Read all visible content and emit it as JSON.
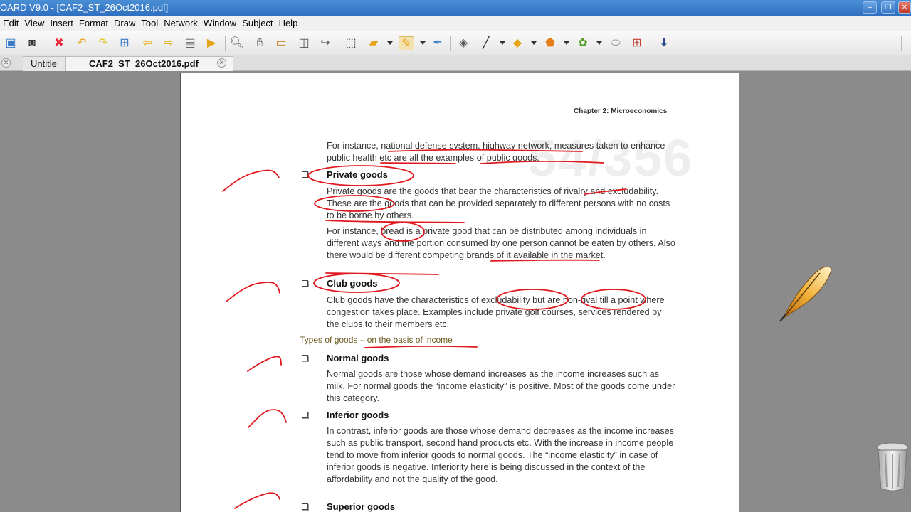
{
  "window": {
    "title": "OARD V9.0 - [CAF2_ST_26Oct2016.pdf]"
  },
  "menu": [
    "Edit",
    "View",
    "Insert",
    "Format",
    "Draw",
    "Tool",
    "Network",
    "Window",
    "Subject",
    "Help"
  ],
  "tabs": [
    {
      "label": "Untitle"
    },
    {
      "label": "CAF2_ST_26Oct2016.pdf"
    }
  ],
  "doc": {
    "chapter_header": "Chapter 2: Microeconomics",
    "watermark": "54/356",
    "intro_para": "For instance, national defense system, highway network, measures taken to enhance public health etc are all the examples of public goods.",
    "private": {
      "heading": "Private goods",
      "p1": "Private goods are the goods that bear the characteristics of rivalry and excludability. These are the goods that can be provided separately to different persons with no costs to be borne by others.",
      "p2": "For instance, bread is a private good that can be distributed among individuals in different ways and the portion consumed by one person cannot be eaten by others. Also there would be different competing brands of it available in the market."
    },
    "club": {
      "heading": "Club goods",
      "p1": "Club goods have the characteristics of excludability but are non-rival till a point where congestion takes place. Examples include private golf courses, services rendered by the clubs to their members etc."
    },
    "types_heading": "Types of goods – on the basis of income",
    "normal": {
      "heading": "Normal goods",
      "p1": "Normal goods are those whose demand increases as the income increases such as milk. For normal goods the “income elasticity” is positive. Most of the goods come under this category."
    },
    "inferior": {
      "heading": "Inferior goods",
      "p1": "In contrast, inferior goods are those whose demand decreases as the income increases such as public transport, second hand products etc. With the increase in income people tend to move from inferior goods to normal goods. The “income elasticity” in case of inferior goods is negative. Inferiority here is being discussed in the context of the affordability and not the quality of the good."
    },
    "superior": {
      "heading": "Superior goods"
    }
  },
  "colors": {
    "ink": "#e0191f",
    "titlebar": "#3579c9"
  }
}
